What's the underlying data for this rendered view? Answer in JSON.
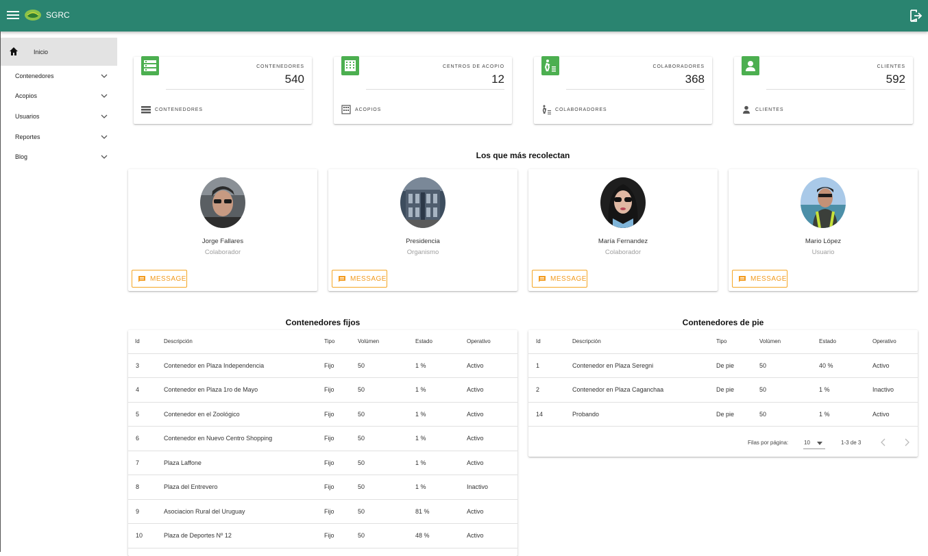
{
  "app": {
    "title": "SGRC"
  },
  "sidebar": {
    "items": [
      {
        "label": "Inicio"
      },
      {
        "label": "Contenedores"
      },
      {
        "label": "Acopios"
      },
      {
        "label": "Usuarios"
      },
      {
        "label": "Reportes"
      },
      {
        "label": "Blog"
      }
    ]
  },
  "stats": [
    {
      "label": "CONTENEDORES",
      "value": "540",
      "footer": "CONTENEDORES",
      "icon": "storage-icon"
    },
    {
      "label": "CENTROS DE ACOPIO",
      "value": "12",
      "footer": "ACOPIOS",
      "icon": "building-icon"
    },
    {
      "label": "COLABORADORES",
      "value": "368",
      "footer": "COLABORADORES",
      "icon": "walker-icon"
    },
    {
      "label": "CLIENTES",
      "value": "592",
      "footer": "CLIENTES",
      "icon": "person-icon"
    }
  ],
  "top": {
    "title": "Los que más recolectan",
    "message_label": "MESSAGE",
    "people": [
      {
        "name": "Jorge Fallares",
        "role": "Colaborador"
      },
      {
        "name": "Presidencia",
        "role": "Organismo"
      },
      {
        "name": "María Fernandez",
        "role": "Colaborador"
      },
      {
        "name": "Mario López",
        "role": "Usuario"
      }
    ]
  },
  "fixed_table": {
    "title": "Contenedores fijos",
    "headers": [
      "Id",
      "Descripción",
      "Tipo",
      "Volúmen",
      "Estado",
      "Operativo"
    ],
    "rows": [
      [
        "3",
        "Contenedor en Plaza Independencia",
        "Fijo",
        "50",
        "1 %",
        "Activo"
      ],
      [
        "4",
        "Contenedor en Plaza 1ro de Mayo",
        "Fijo",
        "50",
        "1 %",
        "Activo"
      ],
      [
        "5",
        "Contenedor en el Zoológico",
        "Fijo",
        "50",
        "1 %",
        "Activo"
      ],
      [
        "6",
        "Contenedor en Nuevo Centro Shopping",
        "Fijo",
        "50",
        "1 %",
        "Activo"
      ],
      [
        "7",
        "Plaza Laffone",
        "Fijo",
        "50",
        "1 %",
        "Activo"
      ],
      [
        "8",
        "Plaza del Entrevero",
        "Fijo",
        "50",
        "1 %",
        "Inactivo"
      ],
      [
        "9",
        "Asociacion Rural del Uruguay",
        "Fijo",
        "50",
        "81 %",
        "Activo"
      ],
      [
        "10",
        "Plaza de Deportes Nº 12",
        "Fijo",
        "50",
        "48 %",
        "Activo"
      ]
    ]
  },
  "pie_table": {
    "title": "Contenedores de pie",
    "headers": [
      "Id",
      "Descripción",
      "Tipo",
      "Volúmen",
      "Estado",
      "Operativo"
    ],
    "rows": [
      [
        "1",
        "Contenedor en Plaza Seregni",
        "De pie",
        "50",
        "40 %",
        "Activo"
      ],
      [
        "2",
        "Contenedor en Plaza Caganchaa",
        "De pie",
        "50",
        "1 %",
        "Inactivo"
      ],
      [
        "14",
        "Probando",
        "De pie",
        "50",
        "1 %",
        "Activo"
      ]
    ],
    "pagination": {
      "rows_label": "Filas por página:",
      "rows_per_page": "10",
      "range": "1-3 de 3"
    }
  },
  "colors": {
    "appbar": "#2a8470",
    "stat_icon": "#4caf50",
    "accent_orange": "#f29a1d",
    "active": "#2196f3",
    "inactive": "#f44336"
  }
}
